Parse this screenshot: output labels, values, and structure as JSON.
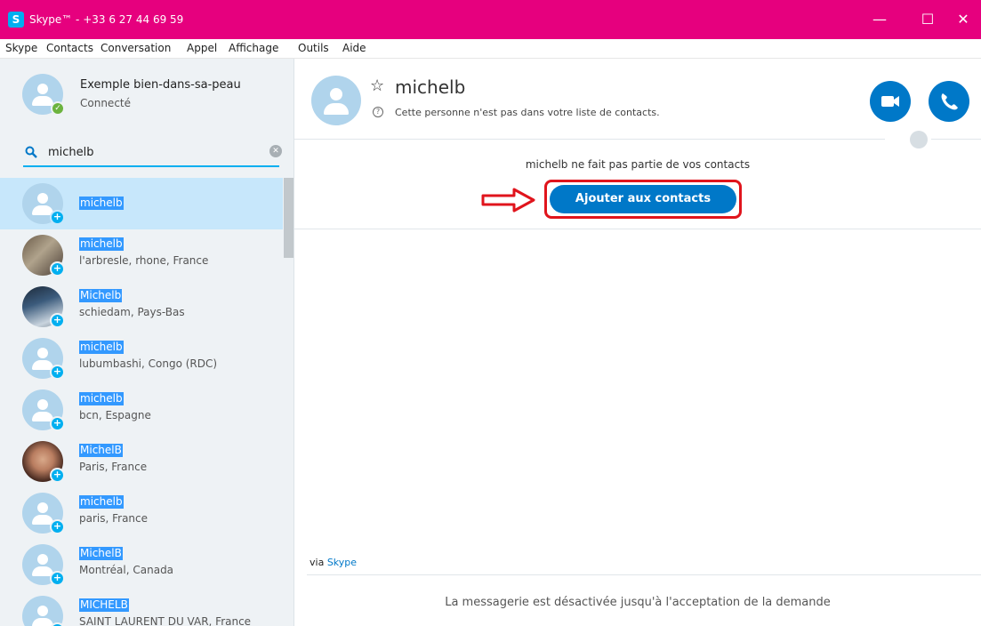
{
  "window": {
    "logo": "S",
    "title": "Skype™ - +33 6 27 44 69 59",
    "controls": {
      "minimize": "—",
      "maximize": "☐",
      "close": "✕"
    }
  },
  "menu": [
    "Skype",
    "Contacts",
    "Conversation",
    "Appel",
    "Affichage",
    "Outils",
    "Aide"
  ],
  "profile": {
    "name": "Exemple bien-dans-sa-peau",
    "status": "Connecté",
    "status_color": "#6cb33e"
  },
  "search": {
    "value": "michelb",
    "icon": "search-icon",
    "clear_icon": "clear-icon"
  },
  "results": [
    {
      "name": "michelb",
      "location": "",
      "avatar": "default",
      "selected": true
    },
    {
      "name": "michelb",
      "location": "l'arbresle, rhone, France",
      "avatar": "photo"
    },
    {
      "name": "Michelb",
      "location": "schiedam, Pays-Bas",
      "avatar": "photo"
    },
    {
      "name": "michelb",
      "location": "lubumbashi, Congo (RDC)",
      "avatar": "default"
    },
    {
      "name": "michelb",
      "location": "bcn, Espagne",
      "avatar": "default"
    },
    {
      "name": "MichelB",
      "location": "Paris, France",
      "avatar": "photo"
    },
    {
      "name": "michelb",
      "location": "paris, France",
      "avatar": "default"
    },
    {
      "name": "MichelB",
      "location": "Montréal, Canada",
      "avatar": "default"
    },
    {
      "name": "MICHELB",
      "location": "SAINT LAURENT DU VAR, France",
      "avatar": "default"
    }
  ],
  "conversation": {
    "contact_name": "michelb",
    "not_in_contacts_info": "Cette personne n'est pas dans votre liste de contacts.",
    "not_contact_notice": "michelb ne fait pas partie de vos contacts",
    "add_button": "Ajouter aux contacts",
    "via_prefix": "via",
    "via_link": "Skype",
    "messaging_disabled": "La messagerie est désactivée jusqu'à l'acceptation de la demande"
  },
  "colors": {
    "titlebar": "#e6007e",
    "accent": "#0078c8",
    "highlight": "#3399ff",
    "annotation_red": "#e0141c"
  }
}
